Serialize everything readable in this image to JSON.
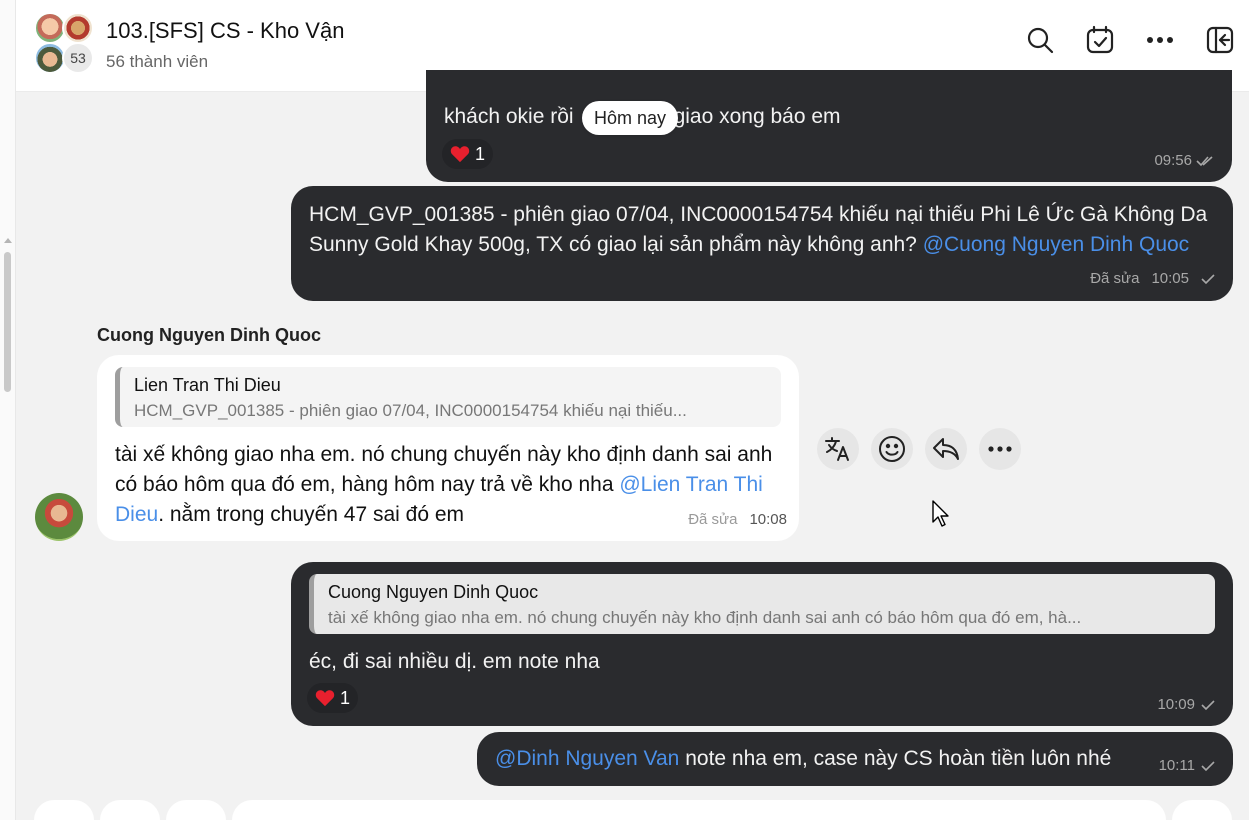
{
  "header": {
    "title": "103.[SFS] CS - Kho Vận",
    "member_count_label": "56 thành viên",
    "avatar_badge": "53",
    "icons": [
      "search-icon",
      "calendar-check-icon",
      "more-icon",
      "collapse-panel-icon"
    ]
  },
  "date_separator": "Hôm nay",
  "messages": [
    {
      "text": "khách okie rồi",
      "text_after": "giao xong báo em",
      "reaction_count": "1",
      "time": "09:56"
    },
    {
      "text": "HCM_GVP_001385 - phiên giao 07/04, INC0000154754 khiếu nại thiếu Phi Lê Ức Gà Không Da Sunny Gold Khay 500g, TX có giao lại sản phẩm này không anh? ",
      "mention": "@Cuong Nguyen Dinh Quoc",
      "edited": "Đã sửa",
      "time": "10:05"
    },
    {
      "sender": "Cuong Nguyen Dinh Quoc",
      "quote_author": "Lien Tran Thi Dieu",
      "quote_text": "HCM_GVP_001385 - phiên giao 07/04, INC0000154754 khiếu nại thiếu...",
      "text_before": "tài xế không giao nha em. nó chung chuyến này kho định danh sai anh có báo hôm qua đó em, hàng hôm nay trả về kho nha ",
      "mention": "@Lien Tran Thi Dieu",
      "text_after": ". nằm trong chuyến 47 sai đó em",
      "edited": "Đã sửa",
      "time": "10:08"
    },
    {
      "quote_author": "Cuong Nguyen Dinh Quoc",
      "quote_text": "tài xế không giao nha em. nó chung chuyến này kho định danh sai anh có báo hôm qua đó em, hà...",
      "text": "éc, đi sai nhiều dị. em note nha",
      "reaction_count": "1",
      "time": "10:09"
    },
    {
      "mention": "@Dinh Nguyen Van",
      "text": " note nha em, case này CS hoàn tiền luôn nhé",
      "time": "10:11"
    }
  ],
  "message_actions": [
    "translate-icon",
    "emoji-icon",
    "reply-icon",
    "more-icon"
  ],
  "colors": {
    "dark_bubble": "#2a2b2e",
    "mention": "#4a8fe8",
    "background": "#f2f2f2"
  }
}
